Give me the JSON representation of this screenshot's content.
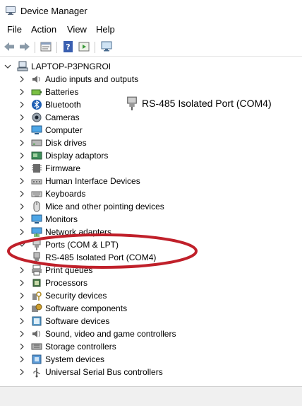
{
  "window": {
    "title": "Device Manager"
  },
  "menu": [
    {
      "label": "File"
    },
    {
      "label": "Action"
    },
    {
      "label": "View"
    },
    {
      "label": "Help"
    }
  ],
  "tree": {
    "root": {
      "label": "LAPTOP-P3PNGROI"
    },
    "items": [
      {
        "label": "Audio inputs and outputs",
        "icon": "speaker-icon"
      },
      {
        "label": "Batteries",
        "icon": "battery-icon"
      },
      {
        "label": "Bluetooth",
        "icon": "bluetooth-icon"
      },
      {
        "label": "Cameras",
        "icon": "camera-icon"
      },
      {
        "label": "Computer",
        "icon": "computer-icon"
      },
      {
        "label": "Disk drives",
        "icon": "disk-drive-icon"
      },
      {
        "label": "Display adaptors",
        "icon": "display-adapter-icon"
      },
      {
        "label": "Firmware",
        "icon": "firmware-icon"
      },
      {
        "label": "Human Interface Devices",
        "icon": "hid-icon"
      },
      {
        "label": "Keyboards",
        "icon": "keyboard-icon"
      },
      {
        "label": "Mice and other pointing devices",
        "icon": "mouse-icon"
      },
      {
        "label": "Monitors",
        "icon": "monitor-icon"
      },
      {
        "label": "Network adapters",
        "icon": "network-adapter-icon"
      },
      {
        "label": "Ports (COM & LPT)",
        "icon": "port-icon",
        "expanded": true
      },
      {
        "label": "RS-485 Isolated Port (COM4)",
        "icon": "serial-port-icon",
        "child": true
      },
      {
        "label": "Print queues",
        "icon": "printer-icon"
      },
      {
        "label": "Processors",
        "icon": "processor-icon"
      },
      {
        "label": "Security devices",
        "icon": "security-device-icon"
      },
      {
        "label": "Software components",
        "icon": "software-component-icon"
      },
      {
        "label": "Software devices",
        "icon": "software-device-icon"
      },
      {
        "label": "Sound, video and game controllers",
        "icon": "sound-controller-icon"
      },
      {
        "label": "Storage controllers",
        "icon": "storage-controller-icon"
      },
      {
        "label": "System devices",
        "icon": "system-device-icon"
      },
      {
        "label": "Universal Serial Bus controllers",
        "icon": "usb-icon"
      }
    ]
  },
  "callout": {
    "label": "RS-485 Isolated Port (COM4)",
    "icon": "serial-port-icon"
  },
  "colors": {
    "highlight_ellipse": "#c0202a",
    "tree_text": "#000000",
    "status_bar": "#f0f0f0"
  }
}
